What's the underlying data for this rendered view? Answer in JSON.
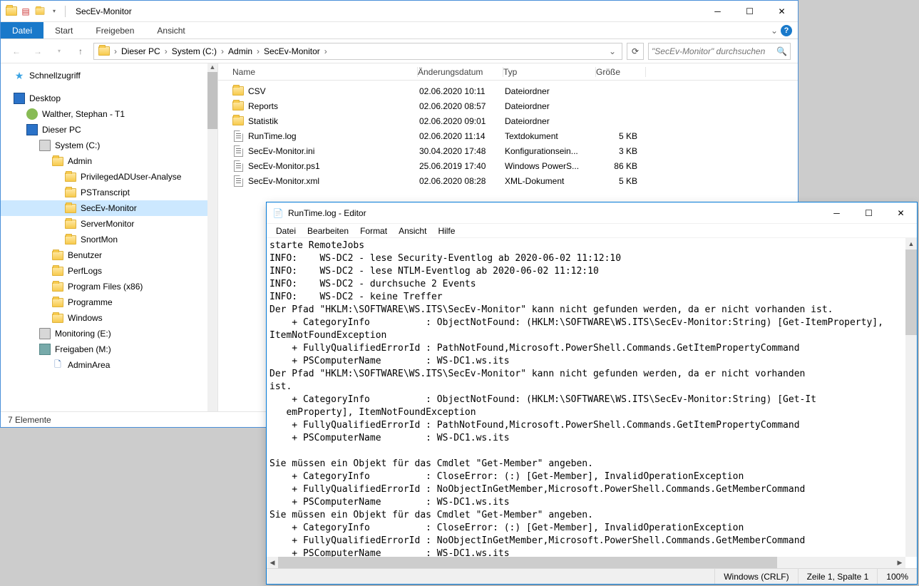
{
  "explorer": {
    "title": "SecEv-Monitor",
    "ribbon": {
      "file": "Datei",
      "start": "Start",
      "share": "Freigeben",
      "view": "Ansicht"
    },
    "breadcrumb": [
      "Dieser PC",
      "System (C:)",
      "Admin",
      "SecEv-Monitor"
    ],
    "search_placeholder": "\"SecEv-Monitor\" durchsuchen",
    "columns": {
      "name": "Name",
      "date": "Änderungsdatum",
      "type": "Typ",
      "size": "Größe"
    },
    "tree_quick": "Schnellzugriff",
    "tree_desktop": "Desktop",
    "tree_user": "Walther, Stephan - T1",
    "tree_pc": "Dieser PC",
    "tree_sysc": "System (C:)",
    "tree_admin": "Admin",
    "tree_items": [
      "PrivilegedADUser-Analyse",
      "PSTranscript",
      "SecEv-Monitor",
      "ServerMonitor",
      "SnortMon"
    ],
    "tree_benutzer": "Benutzer",
    "tree_perflogs": "PerfLogs",
    "tree_pf86": "Program Files (x86)",
    "tree_programme": "Programme",
    "tree_windows": "Windows",
    "tree_mon": "Monitoring (E:)",
    "tree_frei": "Freigaben (M:)",
    "tree_adminarea": "AdminArea",
    "status": "7 Elemente",
    "files": [
      {
        "name": "CSV",
        "date": "02.06.2020 10:11",
        "type": "Dateiordner",
        "size": "",
        "kind": "folder"
      },
      {
        "name": "Reports",
        "date": "02.06.2020 08:57",
        "type": "Dateiordner",
        "size": "",
        "kind": "folder"
      },
      {
        "name": "Statistik",
        "date": "02.06.2020 09:01",
        "type": "Dateiordner",
        "size": "",
        "kind": "folder"
      },
      {
        "name": "RunTime.log",
        "date": "02.06.2020 11:14",
        "type": "Textdokument",
        "size": "5 KB",
        "kind": "txt"
      },
      {
        "name": "SecEv-Monitor.ini",
        "date": "30.04.2020 17:48",
        "type": "Konfigurationsein...",
        "size": "3 KB",
        "kind": "ini"
      },
      {
        "name": "SecEv-Monitor.ps1",
        "date": "25.06.2019 17:40",
        "type": "Windows PowerS...",
        "size": "86 KB",
        "kind": "ps1"
      },
      {
        "name": "SecEv-Monitor.xml",
        "date": "02.06.2020 08:28",
        "type": "XML-Dokument",
        "size": "5 KB",
        "kind": "xml"
      }
    ]
  },
  "notepad": {
    "title": "RunTime.log - Editor",
    "menu": {
      "file": "Datei",
      "edit": "Bearbeiten",
      "format": "Format",
      "view": "Ansicht",
      "help": "Hilfe"
    },
    "status": {
      "eol": "Windows (CRLF)",
      "pos": "Zeile 1, Spalte 1",
      "zoom": "100%"
    },
    "text": "starte RemoteJobs\nINFO:    WS-DC2 - lese Security-Eventlog ab 2020-06-02 11:12:10\nINFO:    WS-DC2 - lese NTLM-Eventlog ab 2020-06-02 11:12:10\nINFO:    WS-DC2 - durchsuche 2 Events\nINFO:    WS-DC2 - keine Treffer\nDer Pfad \"HKLM:\\SOFTWARE\\WS.ITS\\SecEv-Monitor\" kann nicht gefunden werden, da er nicht vorhanden ist.\n    + CategoryInfo          : ObjectNotFound: (HKLM:\\SOFTWARE\\WS.ITS\\SecEv-Monitor:String) [Get-ItemProperty], \nItemNotFoundException\n    + FullyQualifiedErrorId : PathNotFound,Microsoft.PowerShell.Commands.GetItemPropertyCommand\n    + PSComputerName        : WS-DC1.ws.its\nDer Pfad \"HKLM:\\SOFTWARE\\WS.ITS\\SecEv-Monitor\" kann nicht gefunden werden, da er nicht vorhanden \nist.\n    + CategoryInfo          : ObjectNotFound: (HKLM:\\SOFTWARE\\WS.ITS\\SecEv-Monitor:String) [Get-It \n   emProperty], ItemNotFoundException\n    + FullyQualifiedErrorId : PathNotFound,Microsoft.PowerShell.Commands.GetItemPropertyCommand\n    + PSComputerName        : WS-DC1.ws.its\n \nSie müssen ein Objekt für das Cmdlet \"Get-Member\" angeben.\n    + CategoryInfo          : CloseError: (:) [Get-Member], InvalidOperationException\n    + FullyQualifiedErrorId : NoObjectInGetMember,Microsoft.PowerShell.Commands.GetMemberCommand\n    + PSComputerName        : WS-DC1.ws.its\nSie müssen ein Objekt für das Cmdlet \"Get-Member\" angeben.\n    + CategoryInfo          : CloseError: (:) [Get-Member], InvalidOperationException\n    + FullyQualifiedErrorId : NoObjectInGetMember,Microsoft.PowerShell.Commands.GetMemberCommand\n    + PSComputerName        : WS-DC1.ws.its"
  }
}
